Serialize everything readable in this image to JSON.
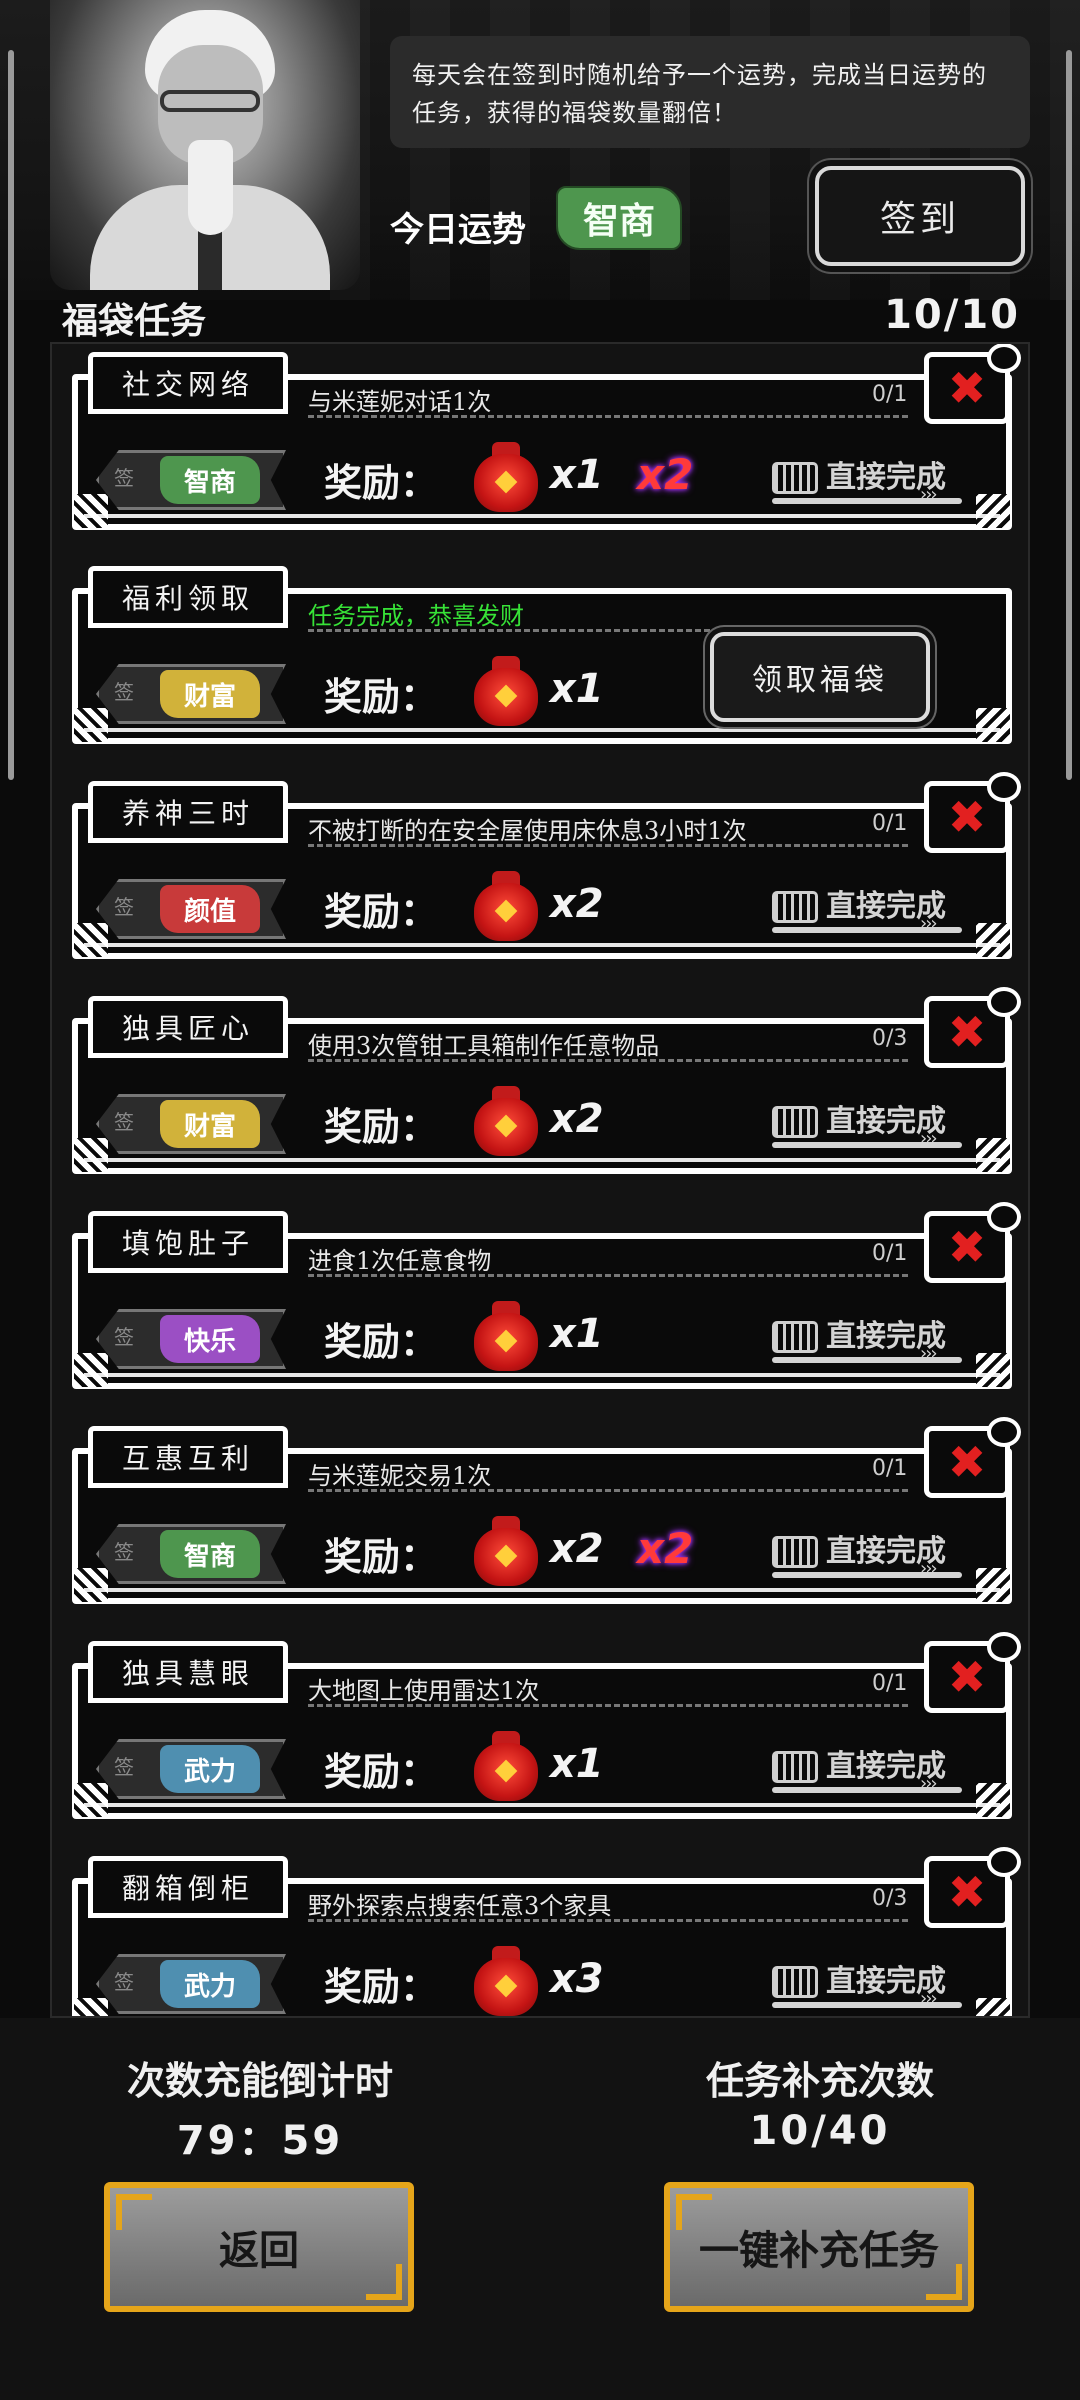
{
  "header": {
    "speech": "每天会在签到时随机给予一个运势，完成当日运势的任务，获得的福袋数量翻倍！",
    "fortune_label": "今日运势",
    "fortune_value": "智商",
    "fortune_color": "#4e964e",
    "checkin_label": "签到"
  },
  "section": {
    "title": "福袋任务",
    "count": "10/10"
  },
  "reward_label": "奖励：",
  "direct_label": "直接完成",
  "sign_char": "签",
  "tasks": [
    {
      "name": "社交网络",
      "desc": "与米莲妮对话1次",
      "progress": "0/1",
      "tag": "智商",
      "tag_color": "#4e964e",
      "qty": "x1",
      "mult": "x2"
    },
    {
      "name": "福利领取",
      "desc": "任务完成，恭喜发财",
      "progress": "",
      "tag": "财富",
      "tag_color": "#d1b23a",
      "qty": "x1",
      "mult": "",
      "claim": "领取福袋"
    },
    {
      "name": "养神三时",
      "desc": "不被打断的在安全屋使用床休息3小时1次",
      "progress": "0/1",
      "tag": "颜值",
      "tag_color": "#c83a3a",
      "qty": "x2",
      "mult": ""
    },
    {
      "name": "独具匠心",
      "desc": "使用3次管钳工具箱制作任意物品",
      "progress": "0/3",
      "tag": "财富",
      "tag_color": "#d1b23a",
      "qty": "x2",
      "mult": ""
    },
    {
      "name": "填饱肚子",
      "desc": "进食1次任意食物",
      "progress": "0/1",
      "tag": "快乐",
      "tag_color": "#9b4fc4",
      "qty": "x1",
      "mult": ""
    },
    {
      "name": "互惠互利",
      "desc": "与米莲妮交易1次",
      "progress": "0/1",
      "tag": "智商",
      "tag_color": "#4e964e",
      "qty": "x2",
      "mult": "x2"
    },
    {
      "name": "独具慧眼",
      "desc": "大地图上使用雷达1次",
      "progress": "0/1",
      "tag": "武力",
      "tag_color": "#4f8fb0",
      "qty": "x1",
      "mult": ""
    },
    {
      "name": "翻箱倒柜",
      "desc": "野外探索点搜索任意3个家具",
      "progress": "0/3",
      "tag": "武力",
      "tag_color": "#4f8fb0",
      "qty": "x3",
      "mult": ""
    }
  ],
  "footer": {
    "countdown_label": "次数充能倒计时",
    "countdown_value": "79：59",
    "refill_label": "任务补充次数",
    "refill_value": "10/40",
    "back_label": "返回",
    "refill_button_label": "一键补充任务"
  }
}
